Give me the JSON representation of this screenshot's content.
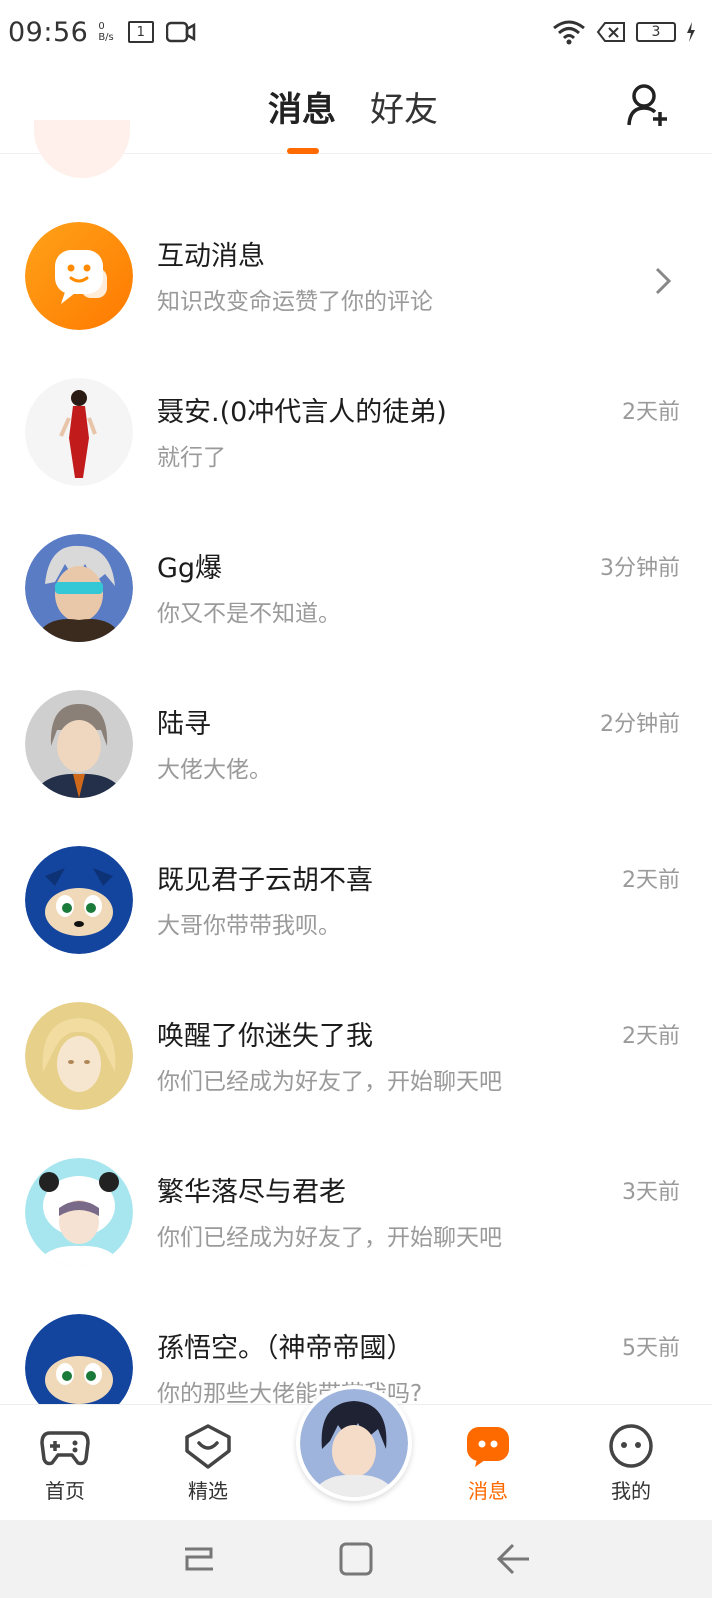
{
  "status_bar": {
    "time": "09:56",
    "net_speed_value": "0",
    "net_speed_unit": "B/s",
    "sim_label": "1",
    "battery": "3"
  },
  "header": {
    "tabs": [
      {
        "label": "消息",
        "active": true
      },
      {
        "label": "好友",
        "active": false
      }
    ],
    "add_friend_icon": "add-user-icon"
  },
  "accent_color": "#ff6a00",
  "conversations": [
    {
      "name": "互动消息",
      "preview": "知识改变命运赞了你的评论",
      "time": "",
      "type": "system"
    },
    {
      "name": "聂安.(0冲代言人的徒弟)",
      "preview": "就行了",
      "time": "2天前"
    },
    {
      "name": "Gg爆",
      "preview": "你又不是不知道。",
      "time": "3分钟前"
    },
    {
      "name": "陆寻",
      "preview": "大佬大佬。",
      "time": "2分钟前"
    },
    {
      "name": "既见君子云胡不喜",
      "preview": "大哥你带带我呗。",
      "time": "2天前"
    },
    {
      "name": "唤醒了你迷失了我",
      "preview": "你们已经成为好友了，开始聊天吧",
      "time": "2天前"
    },
    {
      "name": "繁华落尽与君老",
      "preview": "你们已经成为好友了，开始聊天吧",
      "time": "3天前"
    },
    {
      "name": "孫悟空。（神帝帝國）",
      "preview": "你的那些大佬能带带我吗?",
      "time": "5天前"
    }
  ],
  "bottom_nav": {
    "items": [
      {
        "label": "首页",
        "icon": "gamepad-icon"
      },
      {
        "label": "精选",
        "icon": "heart-badge-icon"
      },
      {
        "label": "消息",
        "icon": "chat-bubble-icon",
        "active": true
      },
      {
        "label": "我的",
        "icon": "smiley-face-icon"
      }
    ]
  }
}
